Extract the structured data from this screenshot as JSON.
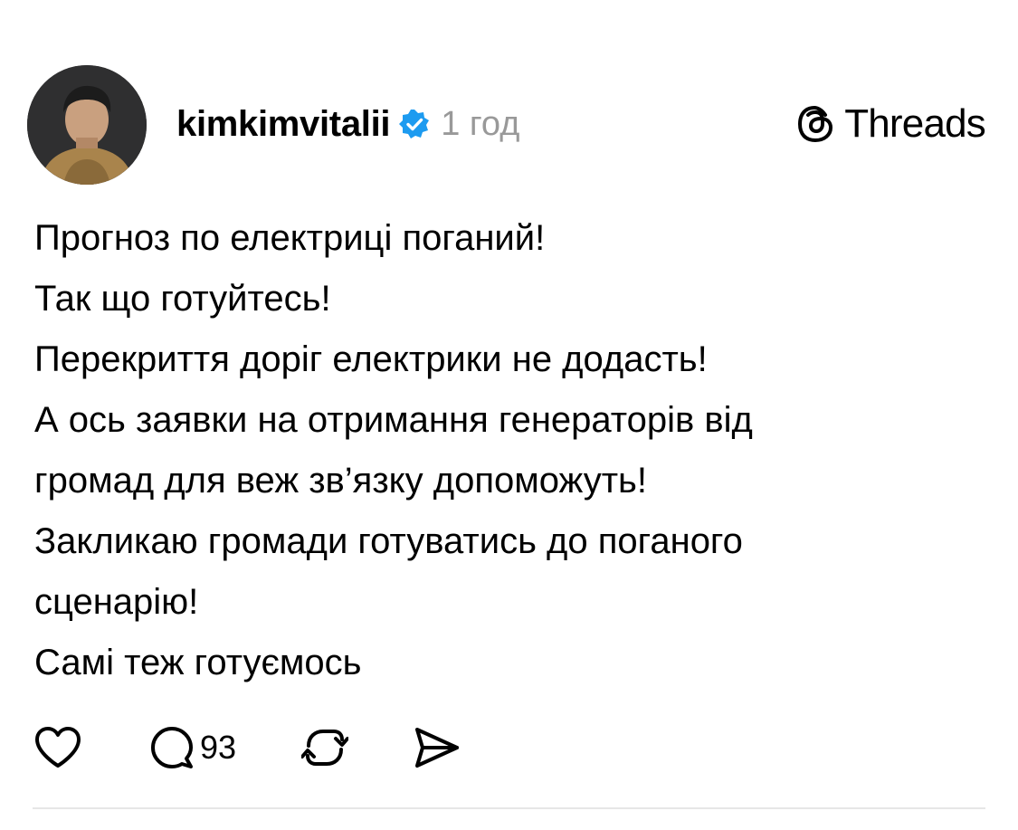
{
  "post": {
    "author": {
      "username": "kimkimvitalii",
      "verified": true,
      "avatar_icon": "avatar"
    },
    "time": "1 год",
    "brand": {
      "name": "Threads",
      "logo_icon": "threads-logo-icon"
    },
    "body_lines": [
      "Прогноз по електриці поганий!",
      "Так що готуйтесь!",
      "Перекриття доріг електрики не додасть!",
      "А ось заявки на отримання генераторів від",
      "громад для веж зв’язку допоможуть!",
      "Закликаю громади готуватись до поганого",
      "сценарію!",
      "Самі теж готуємось"
    ],
    "actions": {
      "like_icon": "heart-icon",
      "reply_icon": "comment-icon",
      "reply_count": "93",
      "repost_icon": "repost-icon",
      "share_icon": "send-icon"
    },
    "colors": {
      "verified_badge": "#1d9bf0",
      "time_text": "#999999",
      "divider": "#e6e6e6"
    }
  }
}
